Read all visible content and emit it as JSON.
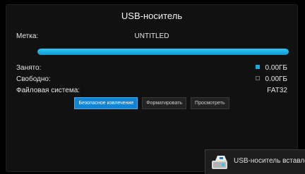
{
  "dialog": {
    "title": "USB-носитель"
  },
  "label_row": {
    "label": "Метка:",
    "value": "UNTITLED"
  },
  "usage": {
    "used_fraction": 1.0
  },
  "stats": {
    "used": {
      "label": "Занято:",
      "value": "0.00ГБ"
    },
    "free": {
      "label": "Свободно:",
      "value": "0.00ГБ"
    },
    "fs": {
      "label": "Файловая система:",
      "value": "FAT32"
    }
  },
  "buttons": {
    "eject": "Безопасное извлечение",
    "format": "Форматировать",
    "browse": "Просмотреть"
  },
  "notification": {
    "text": "USB-носитель вставлен"
  },
  "colors": {
    "accent": "#17a9e6",
    "selected_button": "#0f84d2"
  }
}
